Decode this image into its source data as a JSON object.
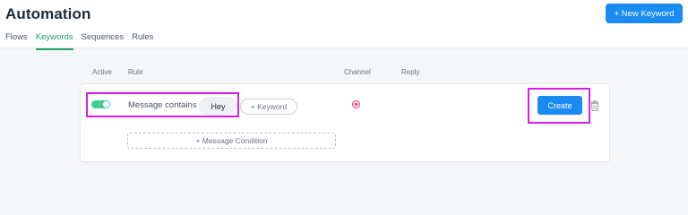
{
  "header": {
    "title": "Automation",
    "new_keyword_label": "+ New Keyword"
  },
  "tabs": [
    {
      "label": "Flows",
      "active": false
    },
    {
      "label": "Keywords",
      "active": true
    },
    {
      "label": "Sequences",
      "active": false
    },
    {
      "label": "Rules",
      "active": false
    }
  ],
  "columns": {
    "active": "Active",
    "rule": "Rule",
    "channel": "Channel",
    "reply": "Reply"
  },
  "rule": {
    "active": true,
    "condition_label": "Message contains",
    "keyword": "Hey",
    "add_keyword_label": "+ Keyword",
    "channel_icon": "instagram-icon",
    "create_label": "Create",
    "add_condition_label": "+ Message Condition"
  },
  "colors": {
    "accent_blue": "#1a8bf0",
    "active_tab_green": "#22a06b",
    "toggle_green": "#3fcf8e",
    "highlight_magenta": "#d21ee6"
  }
}
